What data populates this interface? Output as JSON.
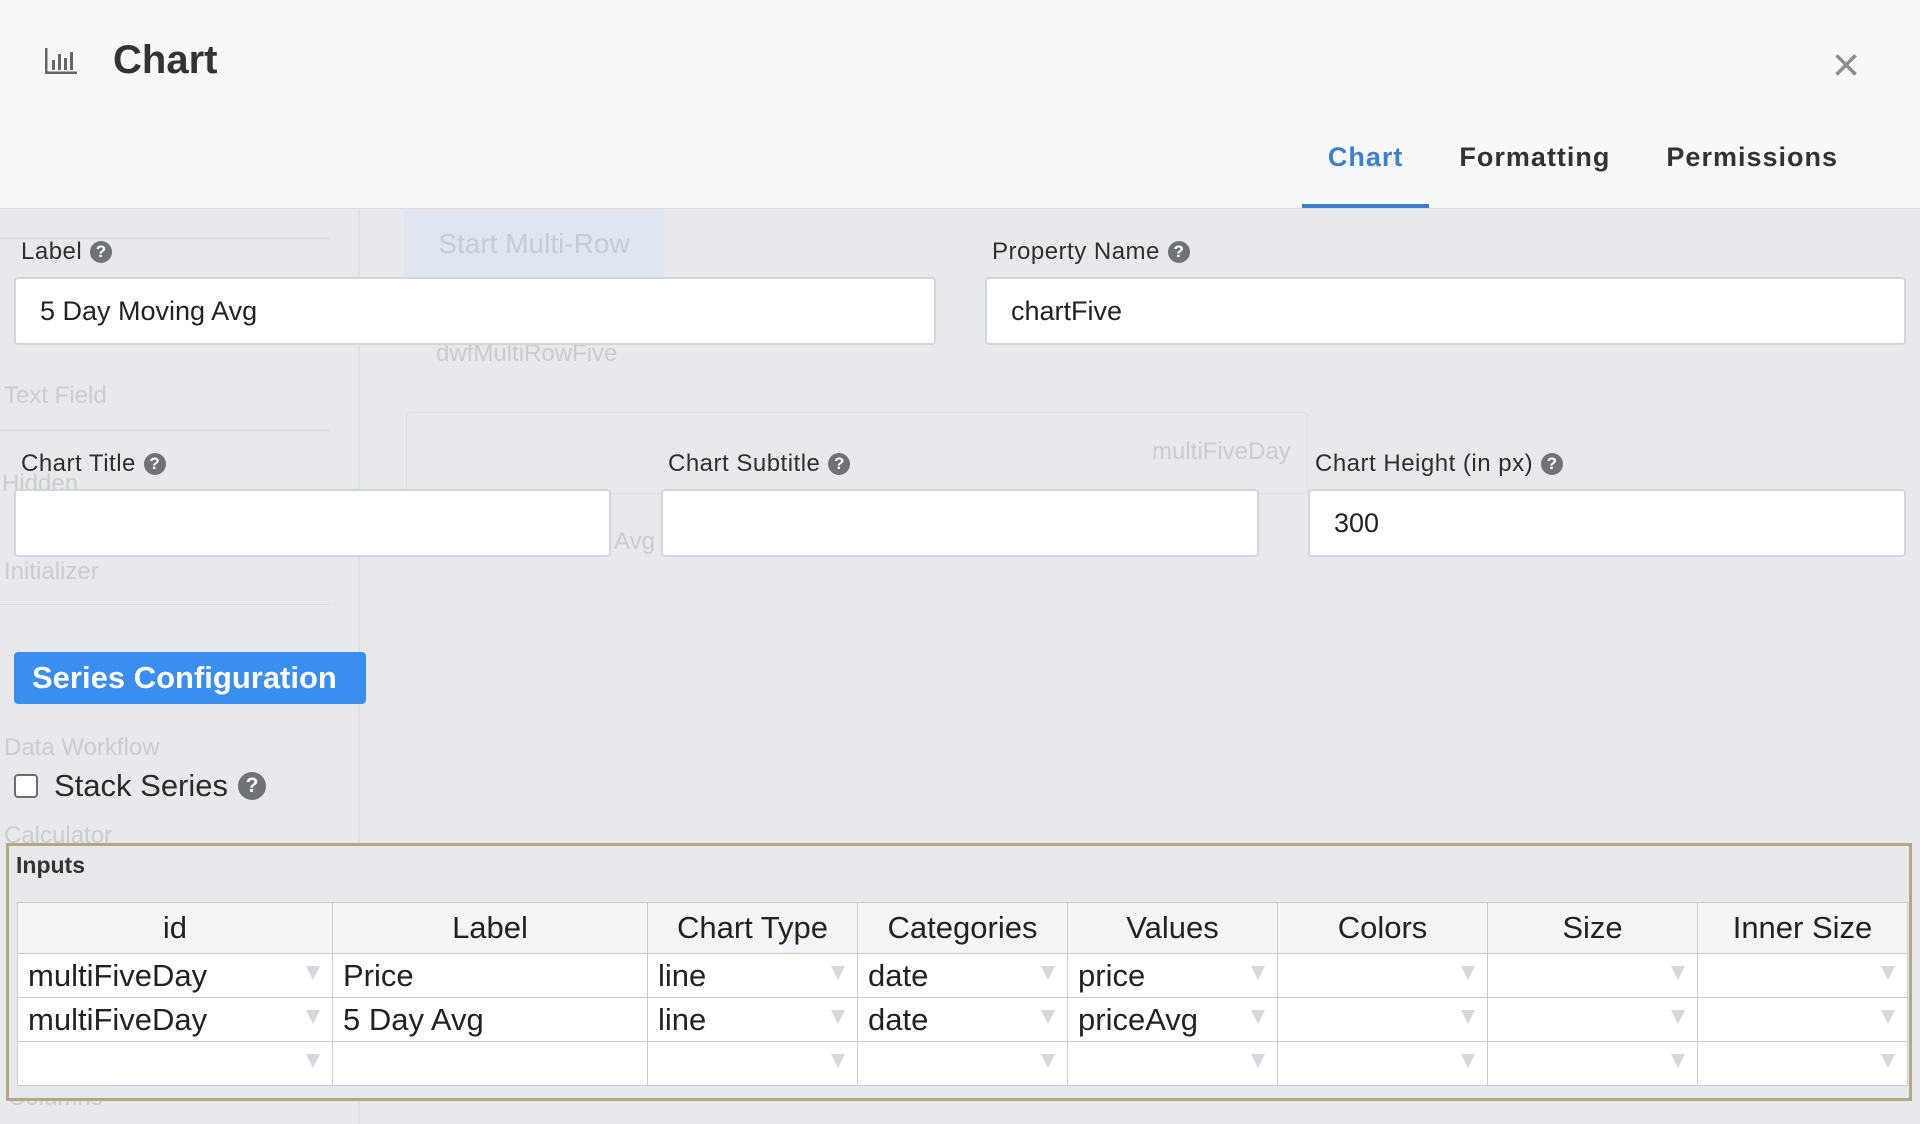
{
  "modal": {
    "title": "Chart",
    "icon": "bar-chart-icon",
    "close_glyph": "×",
    "tabs": [
      {
        "label": "Chart",
        "active": true
      },
      {
        "label": "Formatting",
        "active": false
      },
      {
        "label": "Permissions",
        "active": false
      }
    ]
  },
  "form": {
    "label": {
      "label": "Label",
      "value": "5 Day Moving Avg"
    },
    "property_name": {
      "label": "Property Name",
      "value": "chartFive"
    },
    "chart_title": {
      "label": "Chart Title",
      "value": ""
    },
    "chart_subtitle": {
      "label": "Chart Subtitle",
      "value": ""
    },
    "chart_height": {
      "label": "Chart Height (in px)",
      "value": "300"
    },
    "series_button": "Series Configuration",
    "stack_series": {
      "label": "Stack Series",
      "checked": false
    },
    "help_glyph": "?"
  },
  "inputs": {
    "title": "Inputs",
    "columns": [
      "id",
      "Label",
      "Chart Type",
      "Categories",
      "Values",
      "Colors",
      "Size",
      "Inner Size"
    ],
    "rows": [
      [
        "multiFiveDay",
        "Price",
        "line",
        "date",
        "price",
        "",
        "",
        ""
      ],
      [
        "multiFiveDay",
        "5 Day Avg",
        "line",
        "date",
        "priceAvg",
        "",
        "",
        ""
      ],
      [
        "",
        "",
        "",
        "",
        "",
        "",
        "",
        ""
      ]
    ]
  },
  "background": {
    "ghost_texts": [
      "Start Multi-Row",
      "dwfMultiRowFive",
      "Text Field",
      "Hidden",
      "Initializer",
      "Data Workflow",
      "Calculator",
      "Columns",
      "multiFiveDay",
      "Avg"
    ]
  },
  "colors": {
    "accent": "#3d7fd0",
    "button": "#3a8ef0",
    "panel_border": "#b2a882"
  }
}
